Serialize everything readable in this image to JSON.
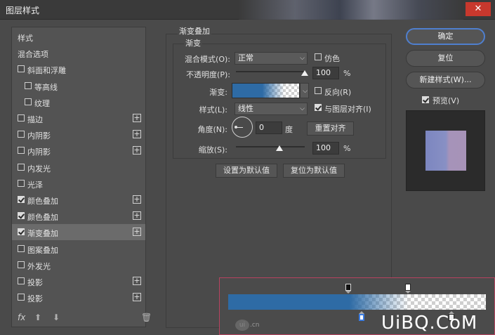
{
  "window": {
    "title": "图层样式",
    "close_icon": "close-icon"
  },
  "left_panel": {
    "items": [
      {
        "label": "样式",
        "checkbox": false,
        "checked": false,
        "plus": false,
        "indent": 0
      },
      {
        "label": "混合选项",
        "checkbox": false,
        "checked": false,
        "plus": false,
        "indent": 0
      },
      {
        "label": "斜面和浮雕",
        "checkbox": true,
        "checked": false,
        "plus": false,
        "indent": 0
      },
      {
        "label": "等高线",
        "checkbox": true,
        "checked": false,
        "plus": false,
        "indent": 1
      },
      {
        "label": "纹理",
        "checkbox": true,
        "checked": false,
        "plus": false,
        "indent": 1
      },
      {
        "label": "描边",
        "checkbox": true,
        "checked": false,
        "plus": true,
        "indent": 0
      },
      {
        "label": "内阴影",
        "checkbox": true,
        "checked": false,
        "plus": true,
        "indent": 0
      },
      {
        "label": "内阴影",
        "checkbox": true,
        "checked": false,
        "plus": true,
        "indent": 0
      },
      {
        "label": "内发光",
        "checkbox": true,
        "checked": false,
        "plus": false,
        "indent": 0
      },
      {
        "label": "光泽",
        "checkbox": true,
        "checked": false,
        "plus": false,
        "indent": 0
      },
      {
        "label": "颜色叠加",
        "checkbox": true,
        "checked": true,
        "plus": true,
        "indent": 0
      },
      {
        "label": "颜色叠加",
        "checkbox": true,
        "checked": true,
        "plus": true,
        "indent": 0
      },
      {
        "label": "渐变叠加",
        "checkbox": true,
        "checked": true,
        "plus": true,
        "indent": 0,
        "selected": true
      },
      {
        "label": "图案叠加",
        "checkbox": true,
        "checked": false,
        "plus": false,
        "indent": 0
      },
      {
        "label": "外发光",
        "checkbox": true,
        "checked": false,
        "plus": false,
        "indent": 0
      },
      {
        "label": "投影",
        "checkbox": true,
        "checked": false,
        "plus": true,
        "indent": 0
      },
      {
        "label": "投影",
        "checkbox": true,
        "checked": false,
        "plus": true,
        "indent": 0
      }
    ],
    "bottom": {
      "fx": "fx",
      "up_icon": "arrow-up-icon",
      "down_icon": "arrow-down-icon",
      "trash_icon": "trash-icon"
    }
  },
  "gradient_overlay": {
    "group_title": "渐变叠加",
    "sub_title": "渐变",
    "blend_mode_label": "混合模式(O):",
    "blend_mode_value": "正常",
    "dither_label": "仿色",
    "dither_checked": false,
    "opacity_label": "不透明度(P):",
    "opacity_value": "100",
    "opacity_fraction": 1.0,
    "percent": "%",
    "gradient_label": "渐变:",
    "reverse_label": "反向(R)",
    "reverse_checked": false,
    "style_label": "样式(L):",
    "style_value": "线性",
    "align_label": "与图层对齐(I)",
    "align_checked": true,
    "angle_label": "角度(N):",
    "angle_value": "0",
    "degree": "度",
    "reset_align_button": "重置对齐",
    "scale_label": "缩放(S):",
    "scale_value": "100",
    "scale_fraction": 0.5,
    "set_default_button": "设置为默认值",
    "reset_default_button": "复位为默认值"
  },
  "right_panel": {
    "ok_button": "确定",
    "reset_button": "复位",
    "new_style_button": "新建样式(W)...",
    "preview_label": "预览(V)",
    "preview_checked": true
  },
  "gradient_editor_inset": {
    "gradient_color": "#2e6ba5",
    "watermark_small": ".cn",
    "watermark_logo": "UiBQ.CoM"
  }
}
